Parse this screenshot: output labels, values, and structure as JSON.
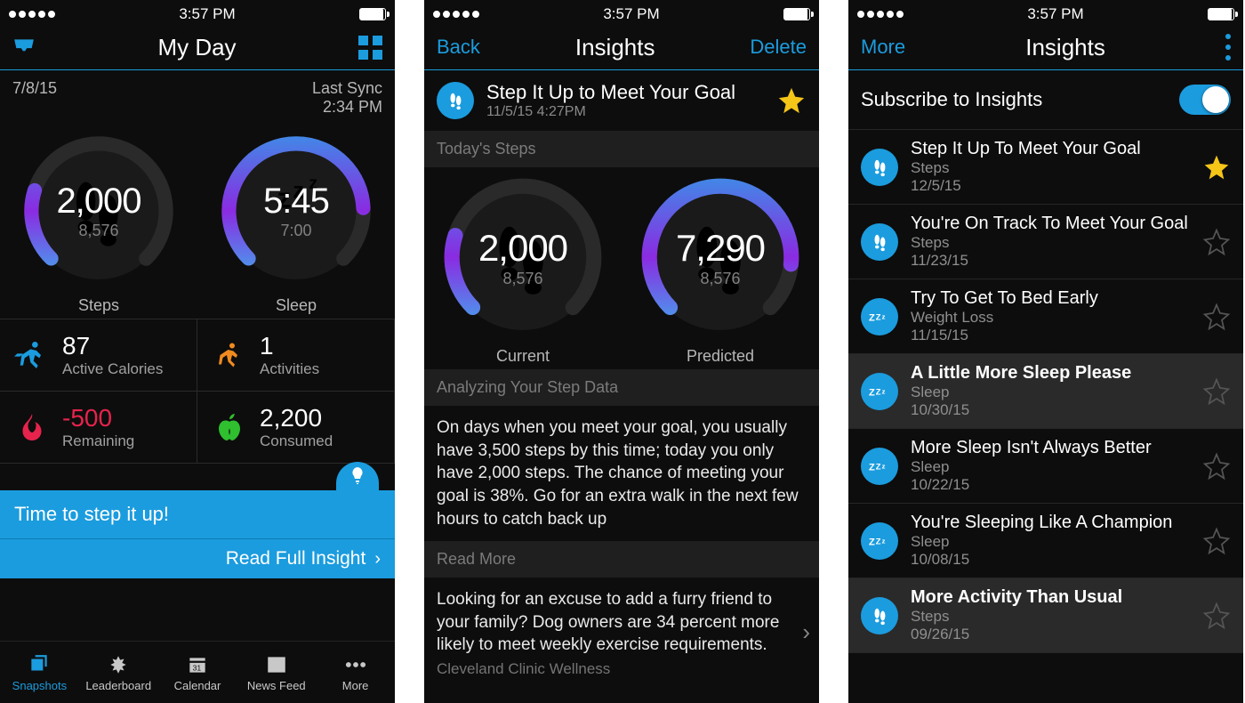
{
  "status": {
    "time": "3:57 PM"
  },
  "s1": {
    "title": "My Day",
    "date": "7/8/15",
    "sync_label": "Last Sync",
    "sync_time": "2:34 PM",
    "steps": {
      "value": "2,000",
      "goal": "8,576",
      "label": "Steps"
    },
    "sleep": {
      "value": "5:45",
      "goal": "7:00",
      "label": "Sleep"
    },
    "active_cal": {
      "value": "87",
      "label": "Active Calories"
    },
    "activities": {
      "value": "1",
      "label": "Activities"
    },
    "remaining": {
      "value": "-500",
      "label": "Remaining"
    },
    "consumed": {
      "value": "2,200",
      "label": "Consumed"
    },
    "banner": "Time to step it up!",
    "read_full": "Read Full Insight",
    "tabs": [
      "Snapshots",
      "Leaderboard",
      "Calendar",
      "News Feed",
      "More"
    ]
  },
  "s2": {
    "back": "Back",
    "title": "Insights",
    "delete": "Delete",
    "insight_title": "Step It Up to Meet Your Goal",
    "insight_ts": "11/5/15 4:27PM",
    "section1": "Today's Steps",
    "current": {
      "value": "2,000",
      "goal": "8,576",
      "label": "Current"
    },
    "predicted": {
      "value": "7,290",
      "goal": "8,576",
      "label": "Predicted"
    },
    "section2": "Analyzing Your Step Data",
    "analysis": "On days when you meet your goal, you usually have 3,500 steps by this time; today you only have 2,000 steps. The chance of meeting your goal is 38%. Go for an extra walk in the next few hours to catch back up",
    "section3": "Read More",
    "readmore_text": "Looking for an excuse to add a furry friend to your family? Dog owners are 34 percent more likely to meet weekly exercise requirements.",
    "readmore_src": "Cleveland Clinic Wellness"
  },
  "s3": {
    "more": "More",
    "title": "Insights",
    "subscribe": "Subscribe to Insights",
    "items": [
      {
        "title": "Step It Up To Meet Your Goal",
        "cat": "Steps",
        "date": "12/5/15",
        "icon": "steps",
        "starred": true,
        "hi": false
      },
      {
        "title": "You're On Track To Meet Your Goal",
        "cat": "Steps",
        "date": "11/23/15",
        "icon": "steps",
        "starred": false,
        "hi": false
      },
      {
        "title": "Try To Get To Bed Early",
        "cat": "Weight Loss",
        "date": "11/15/15",
        "icon": "sleep",
        "starred": false,
        "hi": false
      },
      {
        "title": "A Little More Sleep Please",
        "cat": "Sleep",
        "date": "10/30/15",
        "icon": "sleep",
        "starred": false,
        "hi": true
      },
      {
        "title": "More Sleep Isn't Always Better",
        "cat": "Sleep",
        "date": "10/22/15",
        "icon": "sleep",
        "starred": false,
        "hi": false
      },
      {
        "title": "You're Sleeping Like A Champion",
        "cat": "Sleep",
        "date": "10/08/15",
        "icon": "sleep",
        "starred": false,
        "hi": false
      },
      {
        "title": "More Activity Than Usual",
        "cat": "Steps",
        "date": "09/26/15",
        "icon": "steps",
        "starred": false,
        "hi": true
      }
    ]
  },
  "chart_data": [
    {
      "type": "gauge",
      "label": "Steps",
      "value": 2000,
      "goal": 8576,
      "percent": 23
    },
    {
      "type": "gauge",
      "label": "Sleep",
      "value_hours": 5.75,
      "goal_hours": 7.0,
      "percent": 82
    },
    {
      "type": "gauge",
      "label": "Current",
      "value": 2000,
      "goal": 8576,
      "percent": 23
    },
    {
      "type": "gauge",
      "label": "Predicted",
      "value": 7290,
      "goal": 8576,
      "percent": 85
    }
  ]
}
